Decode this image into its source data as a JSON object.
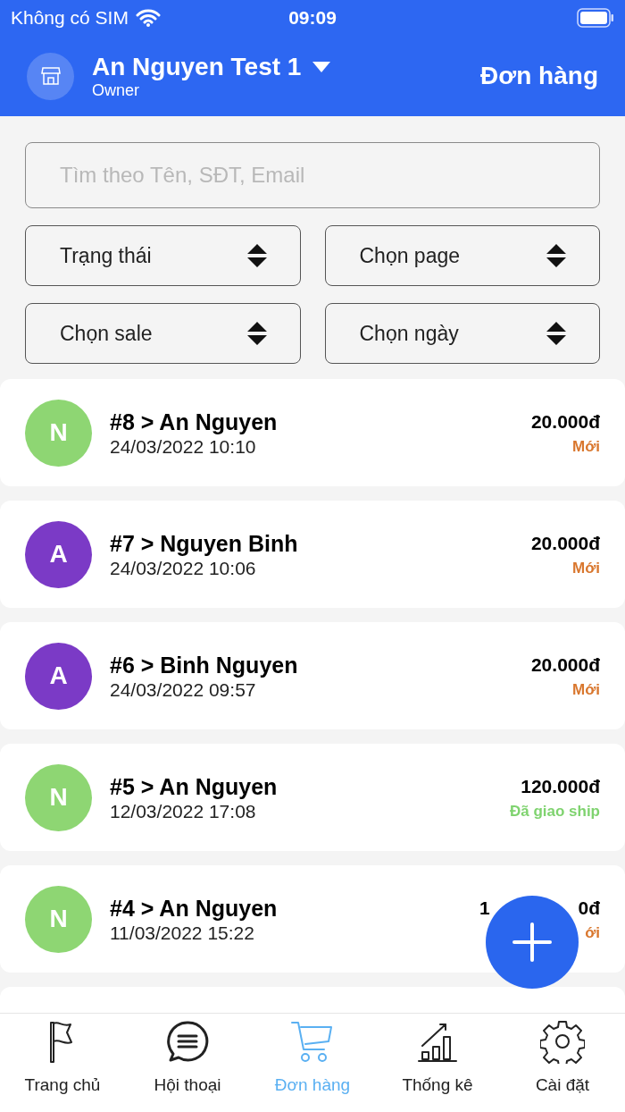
{
  "status_bar": {
    "carrier": "Không có SIM",
    "time": "09:09"
  },
  "header": {
    "shop_name": "An Nguyen Test 1",
    "role": "Owner",
    "title": "Đơn hàng"
  },
  "search": {
    "placeholder": "Tìm theo Tên, SĐT, Email"
  },
  "filters": [
    {
      "label": "Trạng thái"
    },
    {
      "label": "Chọn page"
    },
    {
      "label": "Chọn sale"
    },
    {
      "label": "Chọn ngày"
    }
  ],
  "orders": [
    {
      "avatar": "N",
      "color": "#8ed673",
      "title": "#8 > An Nguyen",
      "date": "24/03/2022 10:10",
      "amount": "20.000đ",
      "status": {
        "text": "Mới",
        "color": "#d9772e"
      }
    },
    {
      "avatar": "A",
      "color": "#7b3ac6",
      "title": "#7 > Nguyen Binh",
      "date": "24/03/2022 10:06",
      "amount": "20.000đ",
      "status": {
        "text": "Mới",
        "color": "#d9772e"
      }
    },
    {
      "avatar": "A",
      "color": "#7b3ac6",
      "title": "#6 > Binh Nguyen",
      "date": "24/03/2022 09:57",
      "amount": "20.000đ",
      "status": {
        "text": "Mới",
        "color": "#d9772e"
      }
    },
    {
      "avatar": "N",
      "color": "#8ed673",
      "title": "#5 > An Nguyen",
      "date": "12/03/2022 17:08",
      "amount": "120.000đ",
      "status": {
        "text": "Đã giao ship",
        "color": "#7fd36f"
      }
    },
    {
      "avatar": "N",
      "color": "#8ed673",
      "title": "#4 > An Nguyen",
      "date": "11/03/2022 15:22",
      "amount_start": "1",
      "amount_end": "0đ",
      "status": {
        "text": "ới",
        "color": "#d9772e"
      }
    }
  ],
  "tabs": [
    {
      "label": "Trang chủ",
      "kind": "flag",
      "selected": false
    },
    {
      "label": "Hội thoại",
      "kind": "chat",
      "selected": false
    },
    {
      "label": "Đơn hàng",
      "kind": "cart",
      "selected": true
    },
    {
      "label": "Thống kê",
      "kind": "chart",
      "selected": false
    },
    {
      "label": "Cài đặt",
      "kind": "gear",
      "selected": false
    }
  ]
}
